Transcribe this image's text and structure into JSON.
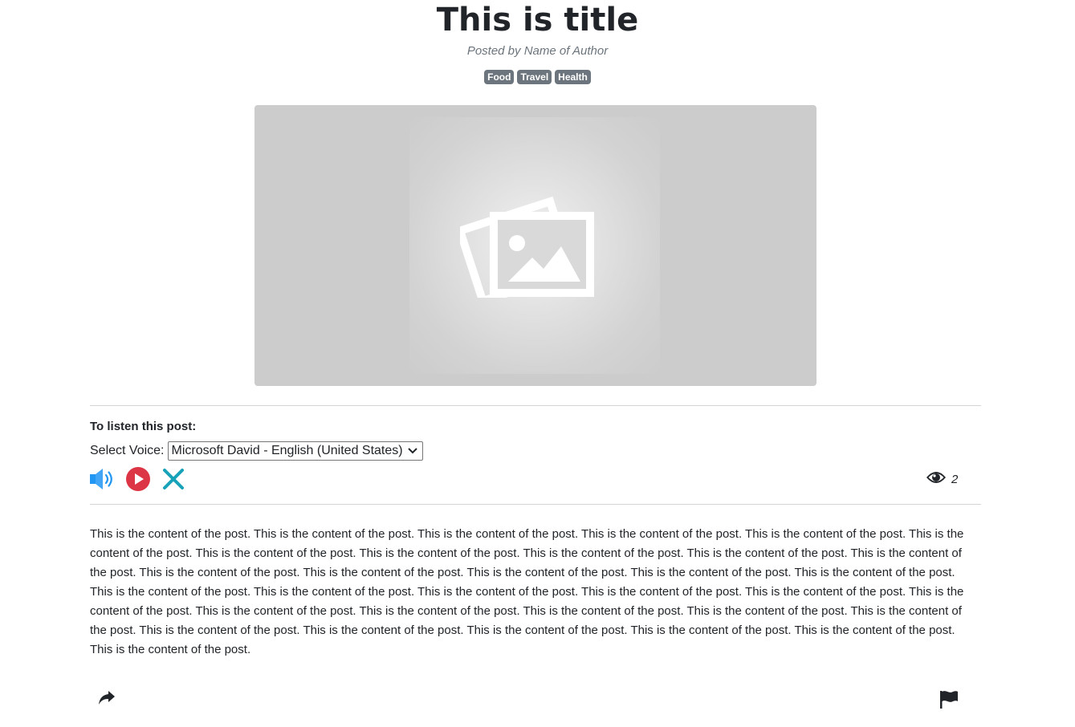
{
  "post": {
    "title": "This is title",
    "author_line": "Posted by Name of Author",
    "tags": [
      "Food",
      "Travel",
      "Health"
    ],
    "content": "This is the content of the post. This is the content of the post. This is the content of the post. This is the content of the post. This is the content of the post. This is the content of the post. This is the content of the post. This is the content of the post. This is the content of the post. This is the content of the post. This is the content of the post. This is the content of the post. This is the content of the post. This is the content of the post. This is the content of the post. This is the content of the post. This is the content of the post. This is the content of the post. This is the content of the post. This is the content of the post. This is the content of the post. This is the content of the post. This is the content of the post. This is the content of the post. This is the content of the post. This is the content of the post. This is the content of the post. This is the content of the post. This is the content of the post. This is the content of the post. This is the content of the post. This is the content of the post. This is the content of the post."
  },
  "hero": {
    "icon": "image-placeholder-icon"
  },
  "listen": {
    "heading": "To listen this post:",
    "voice_label": "Select Voice:",
    "voice_selected": "Microsoft David - English (United States)",
    "controls": [
      {
        "name": "volume-icon",
        "color": "#2196f3"
      },
      {
        "name": "play-icon",
        "color": "#dc3545"
      },
      {
        "name": "close-icon",
        "color": "#17a2b8"
      }
    ]
  },
  "stats": {
    "views_icon": "eye-icon",
    "views_count": "2"
  },
  "footer": {
    "share_icon": "share-icon",
    "flag_icon": "flag-icon"
  },
  "colors": {
    "text": "#212529",
    "muted": "#6c757d",
    "badge": "#6c757d",
    "divider": "#d4d4d4",
    "hero_bg": "#cccccc"
  }
}
